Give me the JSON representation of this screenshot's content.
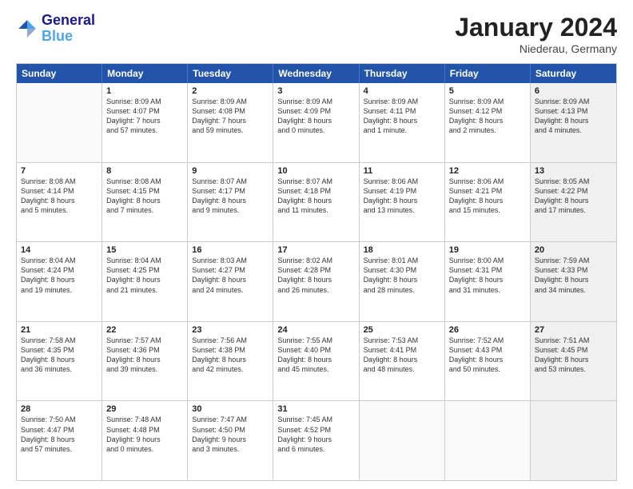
{
  "logo": {
    "line1": "General",
    "line2": "Blue"
  },
  "title": "January 2024",
  "subtitle": "Niederau, Germany",
  "days": [
    "Sunday",
    "Monday",
    "Tuesday",
    "Wednesday",
    "Thursday",
    "Friday",
    "Saturday"
  ],
  "weeks": [
    [
      {
        "num": "",
        "sunrise": "",
        "sunset": "",
        "daylight": "",
        "shaded": false,
        "empty": true
      },
      {
        "num": "1",
        "sunrise": "Sunrise: 8:09 AM",
        "sunset": "Sunset: 4:07 PM",
        "daylight": "Daylight: 7 hours",
        "daylight2": "and 57 minutes.",
        "shaded": false
      },
      {
        "num": "2",
        "sunrise": "Sunrise: 8:09 AM",
        "sunset": "Sunset: 4:08 PM",
        "daylight": "Daylight: 7 hours",
        "daylight2": "and 59 minutes.",
        "shaded": false
      },
      {
        "num": "3",
        "sunrise": "Sunrise: 8:09 AM",
        "sunset": "Sunset: 4:09 PM",
        "daylight": "Daylight: 8 hours",
        "daylight2": "and 0 minutes.",
        "shaded": false
      },
      {
        "num": "4",
        "sunrise": "Sunrise: 8:09 AM",
        "sunset": "Sunset: 4:11 PM",
        "daylight": "Daylight: 8 hours",
        "daylight2": "and 1 minute.",
        "shaded": false
      },
      {
        "num": "5",
        "sunrise": "Sunrise: 8:09 AM",
        "sunset": "Sunset: 4:12 PM",
        "daylight": "Daylight: 8 hours",
        "daylight2": "and 2 minutes.",
        "shaded": false
      },
      {
        "num": "6",
        "sunrise": "Sunrise: 8:09 AM",
        "sunset": "Sunset: 4:13 PM",
        "daylight": "Daylight: 8 hours",
        "daylight2": "and 4 minutes.",
        "shaded": true
      }
    ],
    [
      {
        "num": "7",
        "sunrise": "Sunrise: 8:08 AM",
        "sunset": "Sunset: 4:14 PM",
        "daylight": "Daylight: 8 hours",
        "daylight2": "and 5 minutes.",
        "shaded": false
      },
      {
        "num": "8",
        "sunrise": "Sunrise: 8:08 AM",
        "sunset": "Sunset: 4:15 PM",
        "daylight": "Daylight: 8 hours",
        "daylight2": "and 7 minutes.",
        "shaded": false
      },
      {
        "num": "9",
        "sunrise": "Sunrise: 8:07 AM",
        "sunset": "Sunset: 4:17 PM",
        "daylight": "Daylight: 8 hours",
        "daylight2": "and 9 minutes.",
        "shaded": false
      },
      {
        "num": "10",
        "sunrise": "Sunrise: 8:07 AM",
        "sunset": "Sunset: 4:18 PM",
        "daylight": "Daylight: 8 hours",
        "daylight2": "and 11 minutes.",
        "shaded": false
      },
      {
        "num": "11",
        "sunrise": "Sunrise: 8:06 AM",
        "sunset": "Sunset: 4:19 PM",
        "daylight": "Daylight: 8 hours",
        "daylight2": "and 13 minutes.",
        "shaded": false
      },
      {
        "num": "12",
        "sunrise": "Sunrise: 8:06 AM",
        "sunset": "Sunset: 4:21 PM",
        "daylight": "Daylight: 8 hours",
        "daylight2": "and 15 minutes.",
        "shaded": false
      },
      {
        "num": "13",
        "sunrise": "Sunrise: 8:05 AM",
        "sunset": "Sunset: 4:22 PM",
        "daylight": "Daylight: 8 hours",
        "daylight2": "and 17 minutes.",
        "shaded": true
      }
    ],
    [
      {
        "num": "14",
        "sunrise": "Sunrise: 8:04 AM",
        "sunset": "Sunset: 4:24 PM",
        "daylight": "Daylight: 8 hours",
        "daylight2": "and 19 minutes.",
        "shaded": false
      },
      {
        "num": "15",
        "sunrise": "Sunrise: 8:04 AM",
        "sunset": "Sunset: 4:25 PM",
        "daylight": "Daylight: 8 hours",
        "daylight2": "and 21 minutes.",
        "shaded": false
      },
      {
        "num": "16",
        "sunrise": "Sunrise: 8:03 AM",
        "sunset": "Sunset: 4:27 PM",
        "daylight": "Daylight: 8 hours",
        "daylight2": "and 24 minutes.",
        "shaded": false
      },
      {
        "num": "17",
        "sunrise": "Sunrise: 8:02 AM",
        "sunset": "Sunset: 4:28 PM",
        "daylight": "Daylight: 8 hours",
        "daylight2": "and 26 minutes.",
        "shaded": false
      },
      {
        "num": "18",
        "sunrise": "Sunrise: 8:01 AM",
        "sunset": "Sunset: 4:30 PM",
        "daylight": "Daylight: 8 hours",
        "daylight2": "and 28 minutes.",
        "shaded": false
      },
      {
        "num": "19",
        "sunrise": "Sunrise: 8:00 AM",
        "sunset": "Sunset: 4:31 PM",
        "daylight": "Daylight: 8 hours",
        "daylight2": "and 31 minutes.",
        "shaded": false
      },
      {
        "num": "20",
        "sunrise": "Sunrise: 7:59 AM",
        "sunset": "Sunset: 4:33 PM",
        "daylight": "Daylight: 8 hours",
        "daylight2": "and 34 minutes.",
        "shaded": true
      }
    ],
    [
      {
        "num": "21",
        "sunrise": "Sunrise: 7:58 AM",
        "sunset": "Sunset: 4:35 PM",
        "daylight": "Daylight: 8 hours",
        "daylight2": "and 36 minutes.",
        "shaded": false
      },
      {
        "num": "22",
        "sunrise": "Sunrise: 7:57 AM",
        "sunset": "Sunset: 4:36 PM",
        "daylight": "Daylight: 8 hours",
        "daylight2": "and 39 minutes.",
        "shaded": false
      },
      {
        "num": "23",
        "sunrise": "Sunrise: 7:56 AM",
        "sunset": "Sunset: 4:38 PM",
        "daylight": "Daylight: 8 hours",
        "daylight2": "and 42 minutes.",
        "shaded": false
      },
      {
        "num": "24",
        "sunrise": "Sunrise: 7:55 AM",
        "sunset": "Sunset: 4:40 PM",
        "daylight": "Daylight: 8 hours",
        "daylight2": "and 45 minutes.",
        "shaded": false
      },
      {
        "num": "25",
        "sunrise": "Sunrise: 7:53 AM",
        "sunset": "Sunset: 4:41 PM",
        "daylight": "Daylight: 8 hours",
        "daylight2": "and 48 minutes.",
        "shaded": false
      },
      {
        "num": "26",
        "sunrise": "Sunrise: 7:52 AM",
        "sunset": "Sunset: 4:43 PM",
        "daylight": "Daylight: 8 hours",
        "daylight2": "and 50 minutes.",
        "shaded": false
      },
      {
        "num": "27",
        "sunrise": "Sunrise: 7:51 AM",
        "sunset": "Sunset: 4:45 PM",
        "daylight": "Daylight: 8 hours",
        "daylight2": "and 53 minutes.",
        "shaded": true
      }
    ],
    [
      {
        "num": "28",
        "sunrise": "Sunrise: 7:50 AM",
        "sunset": "Sunset: 4:47 PM",
        "daylight": "Daylight: 8 hours",
        "daylight2": "and 57 minutes.",
        "shaded": false
      },
      {
        "num": "29",
        "sunrise": "Sunrise: 7:48 AM",
        "sunset": "Sunset: 4:48 PM",
        "daylight": "Daylight: 9 hours",
        "daylight2": "and 0 minutes.",
        "shaded": false
      },
      {
        "num": "30",
        "sunrise": "Sunrise: 7:47 AM",
        "sunset": "Sunset: 4:50 PM",
        "daylight": "Daylight: 9 hours",
        "daylight2": "and 3 minutes.",
        "shaded": false
      },
      {
        "num": "31",
        "sunrise": "Sunrise: 7:45 AM",
        "sunset": "Sunset: 4:52 PM",
        "daylight": "Daylight: 9 hours",
        "daylight2": "and 6 minutes.",
        "shaded": false
      },
      {
        "num": "",
        "sunrise": "",
        "sunset": "",
        "daylight": "",
        "daylight2": "",
        "shaded": false,
        "empty": true
      },
      {
        "num": "",
        "sunrise": "",
        "sunset": "",
        "daylight": "",
        "daylight2": "",
        "shaded": false,
        "empty": true
      },
      {
        "num": "",
        "sunrise": "",
        "sunset": "",
        "daylight": "",
        "daylight2": "",
        "shaded": true,
        "empty": true
      }
    ]
  ]
}
